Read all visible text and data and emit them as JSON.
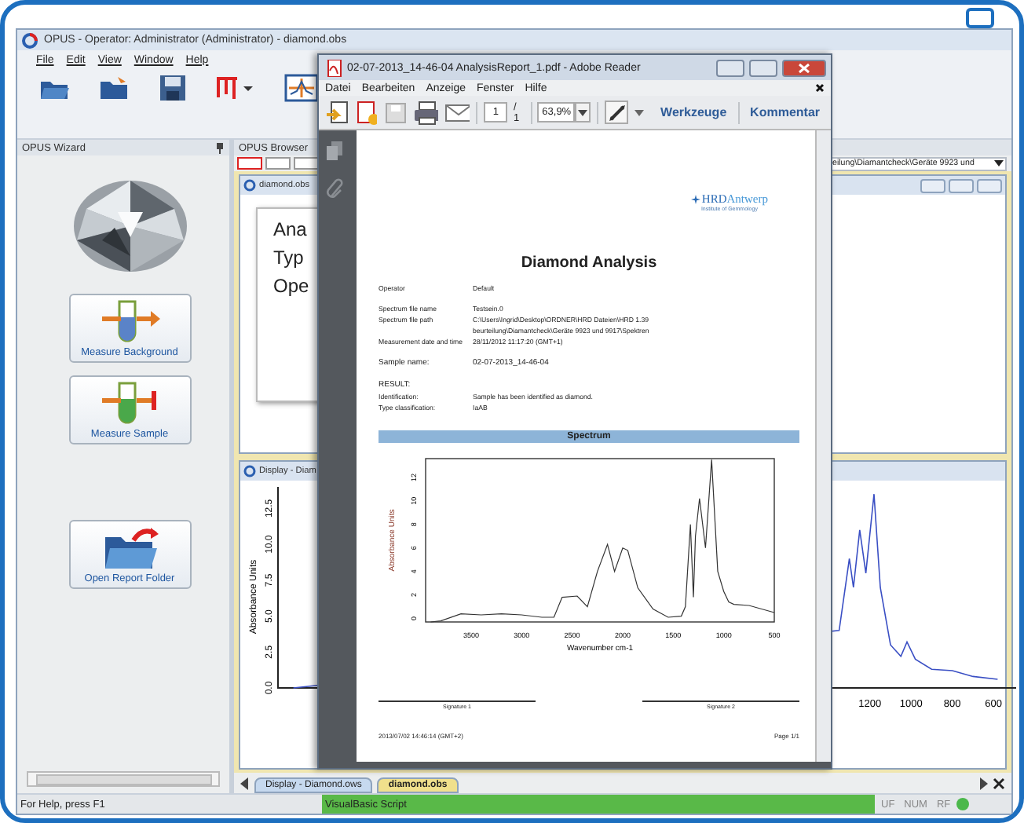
{
  "opus": {
    "title": "OPUS - Operator: Administrator  (Administrator) - diamond.obs",
    "menu": [
      "File",
      "Edit",
      "View",
      "Window",
      "Help"
    ],
    "wizard": {
      "title": "OPUS Wizard",
      "buttons": [
        {
          "label": "Measure Background",
          "kind": "background"
        },
        {
          "label": "Measure Sample",
          "kind": "sample"
        },
        {
          "label": "Open Report Folder",
          "kind": "folder"
        }
      ]
    },
    "browser": {
      "title": "OPUS Browser",
      "path": "eilung\\Diamantcheck\\Geräte 9923 und"
    },
    "obs_window": {
      "title": "diamond.obs",
      "lines": [
        "Ana",
        "Typ",
        "Ope"
      ]
    },
    "display_window": {
      "title": "Display - Diam",
      "chart_data": {
        "type": "line",
        "ylabel": "Absorbance Units",
        "xlim": [
          4075,
          490
        ],
        "ylim": [
          0,
          14
        ],
        "xticks": [
          1200,
          1000,
          800,
          600
        ],
        "yticks": [
          {
            "value": 0,
            "label": "0.0"
          },
          {
            "value": 2.5,
            "label": "2.5"
          },
          {
            "value": 5,
            "label": "5.0"
          },
          {
            "value": 7.5,
            "label": "7.5"
          },
          {
            "value": 10,
            "label": "10.0"
          },
          {
            "value": 12.5,
            "label": "12.5"
          }
        ],
        "x": [
          4000,
          1350,
          1300,
          1280,
          1250,
          1220,
          1180,
          1150,
          1100,
          1050,
          1020,
          980,
          900,
          800,
          700,
          580
        ],
        "series": [
          {
            "color": "#3a4fc4",
            "values": [
              0,
              4,
              9,
              7,
              11,
              8,
              13.5,
              7,
              3,
              2.2,
              3.2,
              2,
              1.3,
              1.2,
              0.8,
              0.6
            ]
          }
        ]
      }
    },
    "doc_tabs": [
      {
        "label": "Display - Diamond.ows",
        "selected": false
      },
      {
        "label": "diamond.obs",
        "selected": true
      }
    ],
    "status_bar": {
      "help": "For Help, press F1",
      "script": "VisualBasic Script",
      "indicators": [
        "UF",
        "NUM",
        "RF"
      ]
    }
  },
  "reader": {
    "title": "02-07-2013_14-46-04 AnalysisReport_1.pdf - Adobe Reader",
    "menu": [
      "Datei",
      "Bearbeiten",
      "Anzeige",
      "Fenster",
      "Hilfe"
    ],
    "page": "1",
    "page_total": "/ 1",
    "zoom": "63,9%",
    "tools": [
      "Werkzeuge",
      "Kommentar"
    ],
    "report": {
      "logo_main": "HRD",
      "logo_accent": "Antwerp",
      "logo_sub": "Institute of Gemmology",
      "title": "Diamond Analysis",
      "field_groups": [
        [
          {
            "kind": "field",
            "label": "Operator",
            "value": "Default"
          }
        ],
        [
          {
            "kind": "field",
            "label": "Spectrum file name",
            "value": "Testsein.0"
          },
          {
            "kind": "field",
            "label": "Spectrum file path",
            "value": "C:\\Users\\Ingrid\\Desktop\\ORDNER\\HRD Dateien\\HRD 1.39"
          },
          {
            "kind": "field",
            "value": "beurteilung\\Diamantcheck\\Geräte 9923 und 9917\\Spektren"
          },
          {
            "kind": "field",
            "label": "Measurement date and time",
            "value": "28/11/2012  11:17:20 (GMT+1)"
          }
        ],
        [
          {
            "kind": "big",
            "label": "Sample name:",
            "value": "02-07-2013_14-46-04"
          }
        ],
        [
          {
            "kind": "heading",
            "label": "RESULT:"
          },
          {
            "kind": "field",
            "label": "Identification:",
            "value": "Sample has been identified as diamond."
          },
          {
            "kind": "field",
            "label": "Type classification:",
            "value": "IaAB"
          }
        ]
      ],
      "spectrum_heading": "Spectrum",
      "chart_data": {
        "type": "line",
        "xlabel": "Wavenumber cm-1",
        "ylabel": "Absorbance Units",
        "xlim": [
          3950,
          500
        ],
        "ylim": [
          -0.3,
          13.6
        ],
        "xticks": [
          3500,
          3000,
          2500,
          2000,
          1500,
          1000,
          500
        ],
        "yticks": [
          0,
          2,
          4,
          6,
          8,
          10,
          12
        ],
        "x": [
          3900,
          3800,
          3600,
          3400,
          3200,
          3000,
          2800,
          2680,
          2600,
          2450,
          2350,
          2250,
          2150,
          2080,
          2000,
          1950,
          1850,
          1700,
          1550,
          1420,
          1380,
          1330,
          1300,
          1280,
          1240,
          1180,
          1120,
          1060,
          1000,
          950,
          900,
          750,
          500
        ],
        "series": [
          {
            "color": "#333333",
            "values": [
              -0.3,
              -0.2,
              0.4,
              0.3,
              0.4,
              0.3,
              0.1,
              0.1,
              1.8,
              1.9,
              1,
              4,
              6.3,
              4,
              6,
              5.8,
              2.6,
              0.8,
              0.1,
              0.2,
              1,
              8,
              1.8,
              7,
              10.2,
              6,
              13.5,
              4,
              2.3,
              1.4,
              1.2,
              1.1,
              0.5
            ]
          }
        ]
      },
      "signatures": [
        "Signature 1",
        "Signature 2"
      ],
      "timestamp": "2013/07/02 14:46:14 (GMT+2)",
      "page": "Page 1/1"
    }
  }
}
